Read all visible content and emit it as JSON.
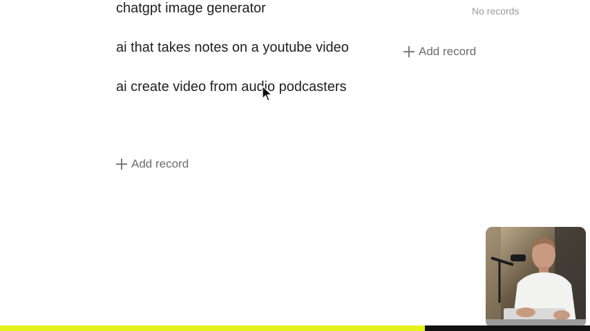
{
  "left_column": {
    "records": [
      "chatgpt image generator",
      "ai that takes notes on a youtube video",
      "ai create video from audio podcasters"
    ],
    "add_record_label": "Add record"
  },
  "right_column": {
    "empty_text": "No records",
    "add_record_label": "Add record"
  },
  "video": {
    "progress": 0.72,
    "progress_color": "#e5f21a"
  },
  "icons": [
    "plus-icon",
    "mouse-pointer-icon"
  ]
}
